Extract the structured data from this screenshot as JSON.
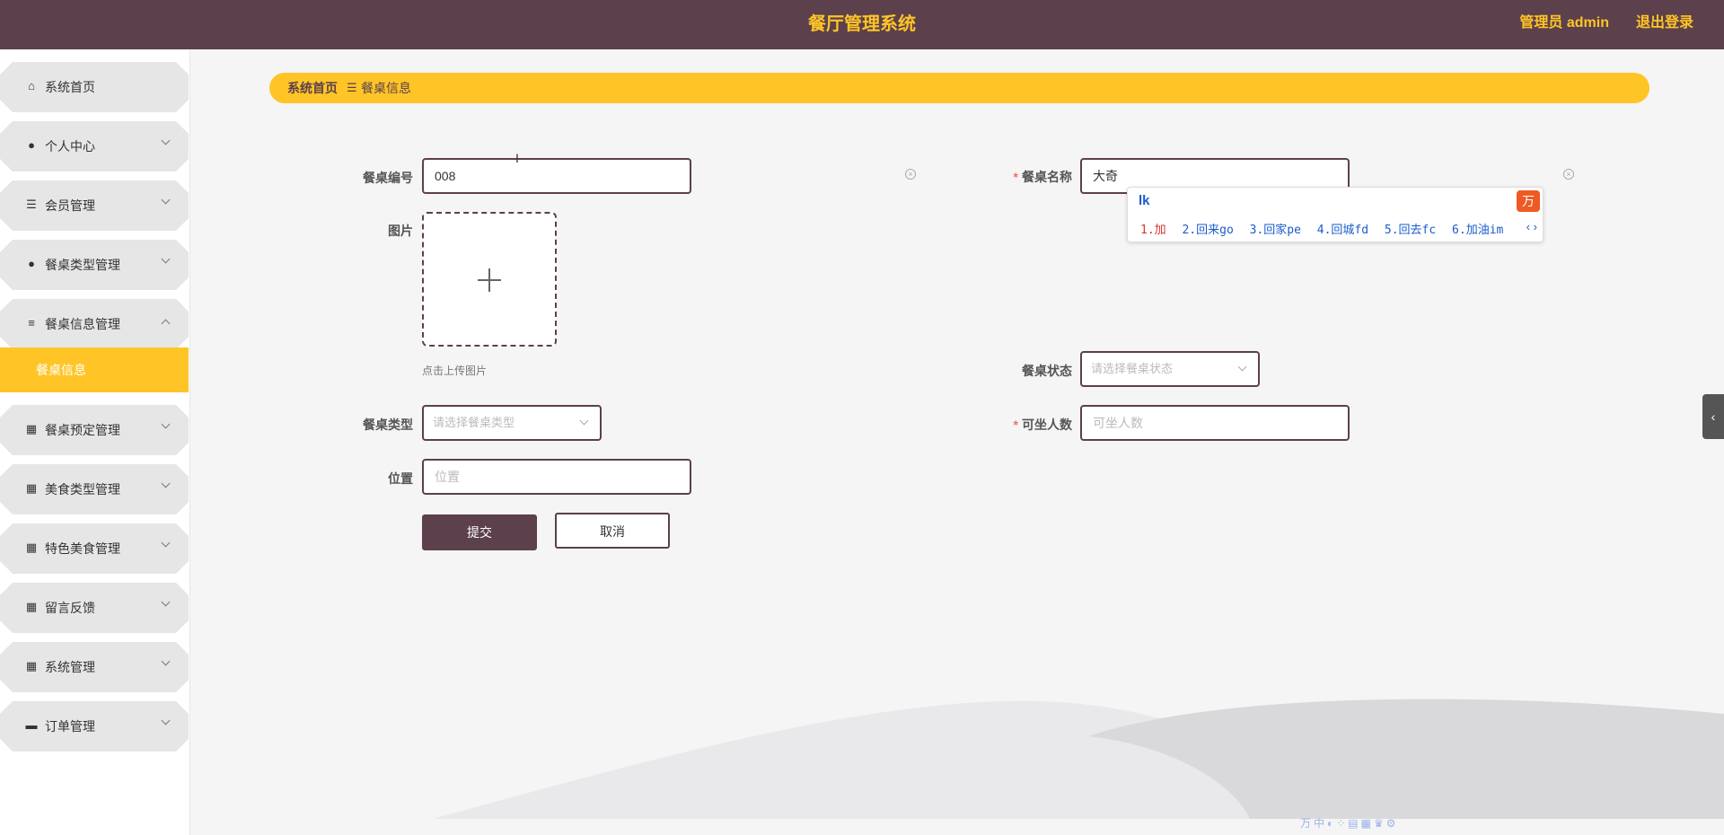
{
  "header": {
    "title": "餐厅管理系统",
    "user_label": "管理员 admin",
    "logout_label": "退出登录"
  },
  "sidebar": {
    "items": [
      {
        "label": "系统首页",
        "icon": "home-icon"
      },
      {
        "label": "个人中心",
        "icon": "person-icon"
      },
      {
        "label": "会员管理",
        "icon": "list-icon"
      },
      {
        "label": "餐桌类型管理",
        "icon": "bulb-icon"
      },
      {
        "label": "餐桌信息管理",
        "icon": "sliders-icon"
      },
      {
        "label": "餐桌预定管理",
        "icon": "grid-icon"
      },
      {
        "label": "美食类型管理",
        "icon": "grid-icon"
      },
      {
        "label": "特色美食管理",
        "icon": "grid9-icon"
      },
      {
        "label": "留言反馈",
        "icon": "grid-icon"
      },
      {
        "label": "系统管理",
        "icon": "grid-icon"
      },
      {
        "label": "订单管理",
        "icon": "ticket-icon"
      }
    ],
    "active_sub": "餐桌信息"
  },
  "breadcrumb": {
    "home": "系统首页",
    "separator": "☰",
    "current": "餐桌信息"
  },
  "form": {
    "table_no": {
      "label": "餐桌编号",
      "value": "008"
    },
    "table_name": {
      "label": "餐桌名称",
      "value": "大奇",
      "required": "*"
    },
    "image": {
      "label": "图片",
      "hint": "点击上传图片"
    },
    "status": {
      "label": "餐桌状态",
      "placeholder": "请选择餐桌状态"
    },
    "type": {
      "label": "餐桌类型",
      "placeholder": "请选择餐桌类型"
    },
    "seats": {
      "label": "可坐人数",
      "placeholder": "可坐人数",
      "required": "*"
    },
    "location": {
      "label": "位置",
      "placeholder": "位置"
    },
    "submit_label": "提交",
    "cancel_label": "取消"
  },
  "ime": {
    "composition": "lk",
    "candidates": [
      "1.加",
      "2.回来go",
      "3.回家pe",
      "4.回城fd",
      "5.回去fc",
      "6.加油im"
    ]
  },
  "colors": {
    "header_bg": "#5c404c",
    "accent": "#ffc526",
    "menu_bg": "#e6e6e6"
  }
}
